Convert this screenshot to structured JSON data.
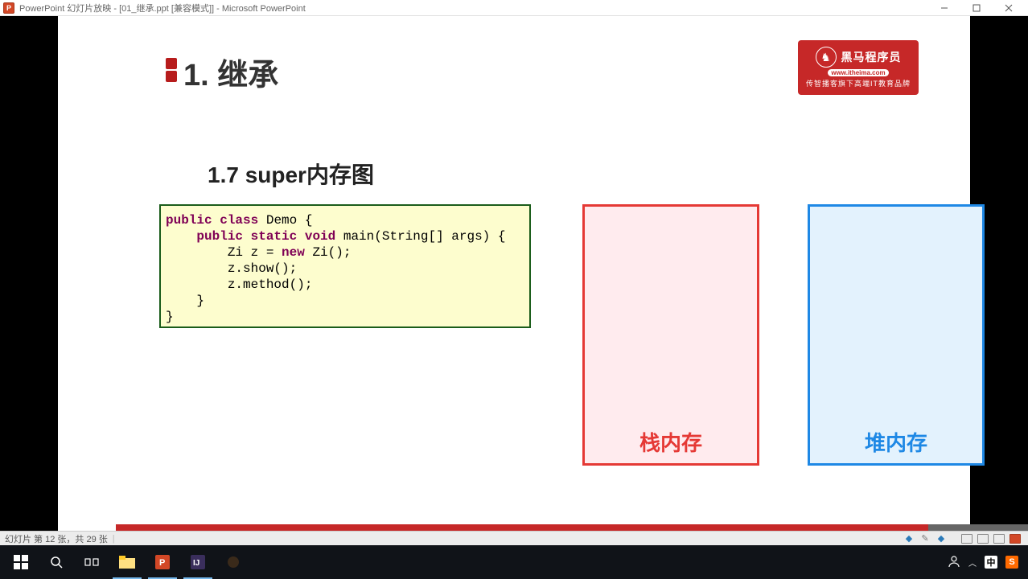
{
  "window": {
    "title": "PowerPoint 幻灯片放映 - [01_继承.ppt [兼容模式]] - Microsoft PowerPoint"
  },
  "slide": {
    "heading": "1. 继承",
    "subheading": "1.7 super内存图",
    "brand": {
      "name": "黑马程序员",
      "url": "www.itheima.com",
      "slogan": "传智播客旗下高端IT教育品牌"
    },
    "code": {
      "kw_public1": "public",
      "kw_class": "class",
      "cls": " Demo {",
      "indent1": "    ",
      "kw_public2": "public",
      "sp1": " ",
      "kw_static": "static",
      "sp2": " ",
      "kw_void": "void",
      "sig": " main(String[] args) {",
      "indent2": "        ",
      "decl1": "Zi z = ",
      "kw_new": "new",
      "decl2": " Zi();",
      "line4": "        z.show();",
      "line5": "        z.method();",
      "line6": "    }",
      "line7": "}"
    },
    "stack_label": "栈内存",
    "heap_label": "堆内存"
  },
  "status": {
    "slide_counter": "幻灯片 第 12 张，共 29 张"
  },
  "tray": {
    "ime": "中",
    "sogou": "S"
  }
}
